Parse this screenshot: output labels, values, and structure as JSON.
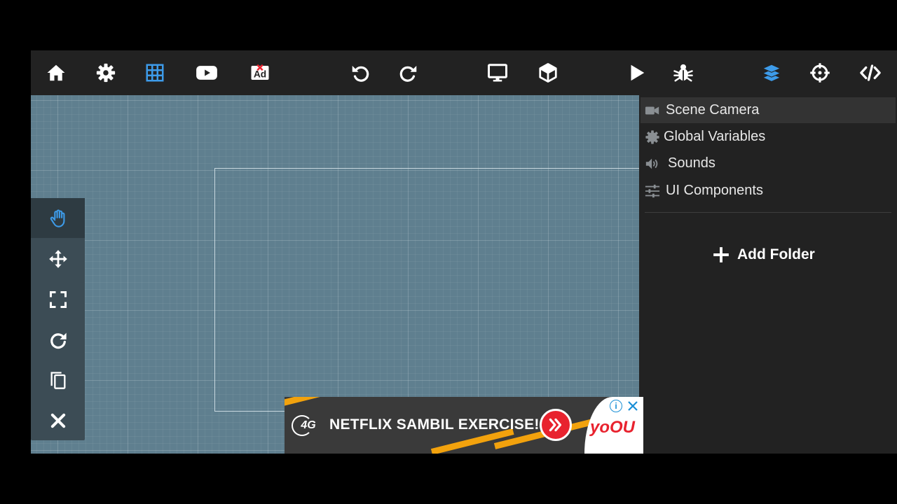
{
  "toolbar": {
    "buttons": [
      {
        "icon": "home-icon"
      },
      {
        "icon": "gear-icon"
      },
      {
        "icon": "grid-icon",
        "active": true
      },
      {
        "icon": "youtube-icon"
      },
      {
        "icon": "ad-icon",
        "text": "Ad"
      },
      {
        "icon": "undo-icon"
      },
      {
        "icon": "redo-icon"
      },
      {
        "icon": "monitor-icon"
      },
      {
        "icon": "cube-icon"
      },
      {
        "icon": "play-icon"
      },
      {
        "icon": "bug-icon"
      },
      {
        "icon": "layers-icon",
        "active": true
      },
      {
        "icon": "crosshair-icon"
      },
      {
        "icon": "code-icon"
      }
    ]
  },
  "side_tools": [
    {
      "icon": "hand-icon",
      "active": true
    },
    {
      "icon": "move-icon"
    },
    {
      "icon": "scale-icon"
    },
    {
      "icon": "rotate-icon"
    },
    {
      "icon": "copy-icon"
    },
    {
      "icon": "close-icon"
    }
  ],
  "panel": {
    "items": [
      {
        "label": "Scene Camera",
        "icon": "video-camera-icon",
        "selected": true
      },
      {
        "label": "Global Variables",
        "icon": "gear-icon"
      },
      {
        "label": "Sounds",
        "icon": "speaker-icon"
      },
      {
        "label": "UI Components",
        "icon": "sliders-icon"
      }
    ],
    "add_folder_label": "Add Folder"
  },
  "ad": {
    "logo": "4G",
    "text": "NETFLIX SAMBIL EXERCISE!",
    "brand": "yoOU",
    "info": "i"
  },
  "colors": {
    "accent": "#3d9be9",
    "toolbar_bg": "#222222",
    "viewport_bg": "#5f7f8f",
    "side_tools_bg": "#3c4c55",
    "ad_red": "#e8222e",
    "ad_orange": "#f2a20d"
  }
}
